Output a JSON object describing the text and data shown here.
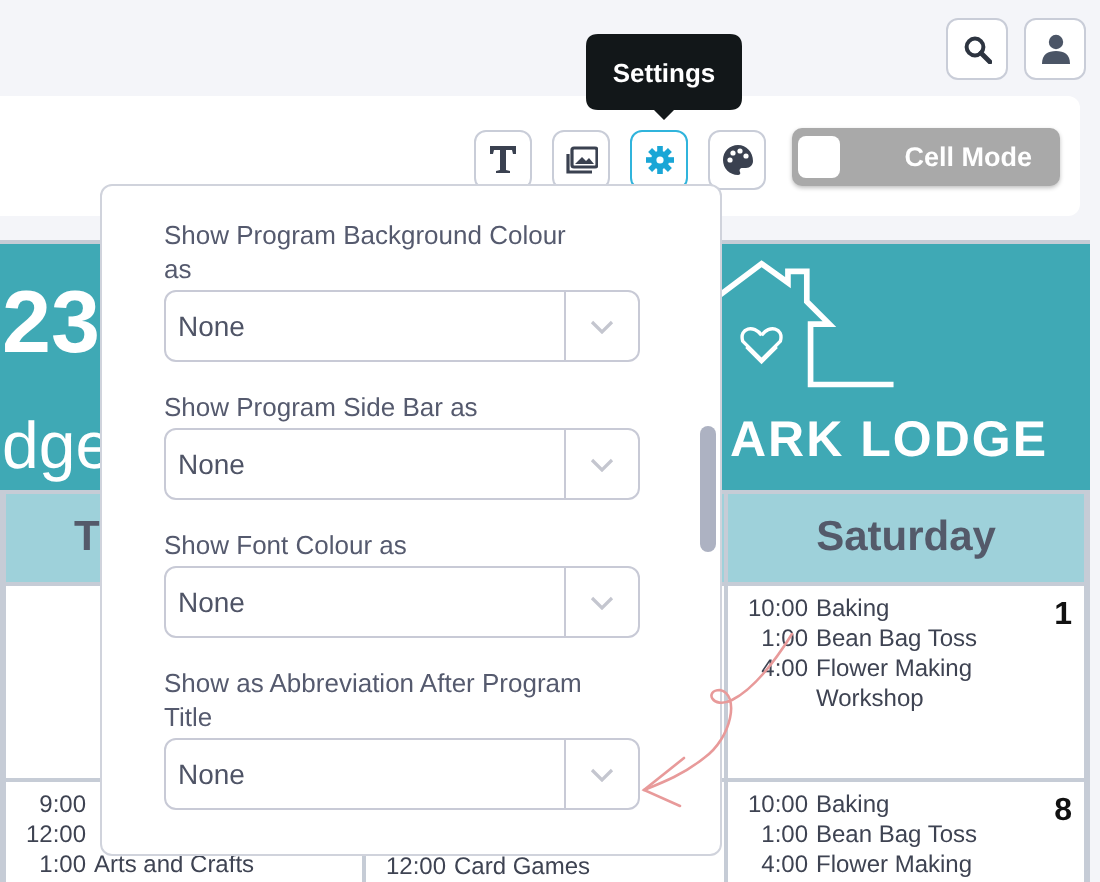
{
  "tooltip": {
    "text": "Settings"
  },
  "tools": [
    {
      "kind": "text",
      "selected": false
    },
    {
      "kind": "images",
      "selected": false
    },
    {
      "kind": "settings",
      "selected": true
    },
    {
      "kind": "palette",
      "selected": false
    }
  ],
  "cell_mode": {
    "label": "Cell Mode",
    "on": false
  },
  "banner": {
    "number": "23",
    "partial_title": "dge",
    "logo_text": "ARK LODGE"
  },
  "day_headers": [
    {
      "label": "T"
    },
    {
      "label": "Saturday"
    }
  ],
  "weeks": [
    {
      "cells": [
        {},
        {},
        {
          "date": "1",
          "events": [
            {
              "time": "10:00",
              "title": "Baking"
            },
            {
              "time": "1:00",
              "title": "Bean Bag Toss"
            },
            {
              "time": "4:00",
              "title": "Flower Making Workshop"
            }
          ]
        }
      ]
    },
    {
      "cells": [
        {
          "events": [
            {
              "time": "9:00"
            },
            {
              "time": "12:00"
            },
            {
              "time": "1:00",
              "title": "Arts and Crafts"
            }
          ]
        },
        {
          "events": [
            {
              "time": "12:00",
              "title": "Card Games"
            }
          ]
        },
        {
          "date": "8",
          "events": [
            {
              "time": "10:00",
              "title": "Baking"
            },
            {
              "time": "1:00",
              "title": "Bean Bag Toss"
            },
            {
              "time": "4:00",
              "title": "Flower Making"
            }
          ]
        }
      ]
    }
  ],
  "settings_panel": {
    "fields": [
      {
        "label": "Show Program Background Colour as",
        "value": "None"
      },
      {
        "label": "Show Program Side Bar as",
        "value": "None"
      },
      {
        "label": "Show Font Colour as",
        "value": "None"
      },
      {
        "label": "Show as Abbreviation After Program Title",
        "value": "None"
      }
    ]
  }
}
